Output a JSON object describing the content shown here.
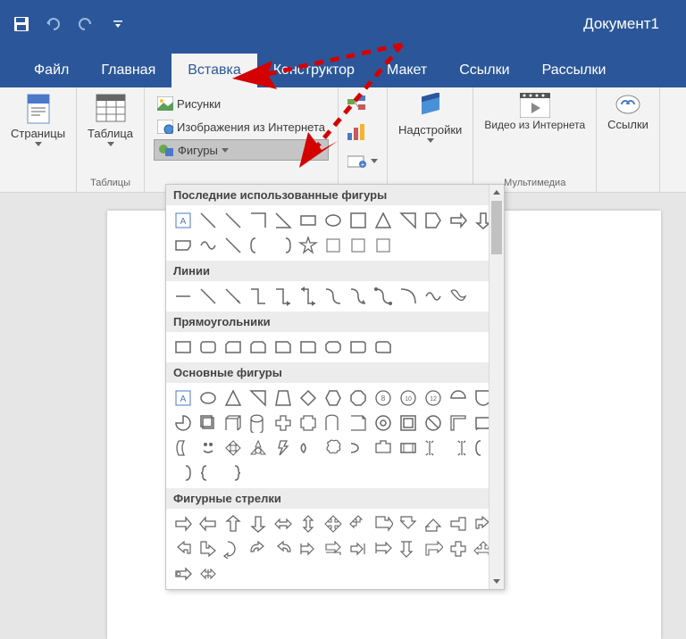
{
  "titlebar": {
    "document_title": "Документ1"
  },
  "tabs": {
    "file": "Файл",
    "home": "Главная",
    "insert": "Вставка",
    "design": "Конструктор",
    "layout": "Макет",
    "references": "Ссылки",
    "mailings": "Рассылки"
  },
  "ribbon": {
    "pages": {
      "label": "Страницы"
    },
    "tables": {
      "label": "Таблица",
      "group_label": "Таблицы"
    },
    "illustrations": {
      "pictures": "Рисунки",
      "online_pictures": "Изображения из Интернета",
      "shapes": "Фигуры"
    },
    "addins": {
      "label": "Надстройки"
    },
    "media": {
      "video": "Видео из Интернета",
      "group_label": "Мультимедиа"
    },
    "links": {
      "label": "Ссылки"
    }
  },
  "shapes_menu": {
    "categories": [
      {
        "id": "recent",
        "title": "Последние использованные фигуры",
        "count": 22
      },
      {
        "id": "lines",
        "title": "Линии",
        "count": 12
      },
      {
        "id": "rectangles",
        "title": "Прямоугольники",
        "count": 9
      },
      {
        "id": "basic",
        "title": "Основные фигуры",
        "count": 42
      },
      {
        "id": "block_arrows",
        "title": "Фигурные стрелки",
        "count": 28
      }
    ]
  }
}
